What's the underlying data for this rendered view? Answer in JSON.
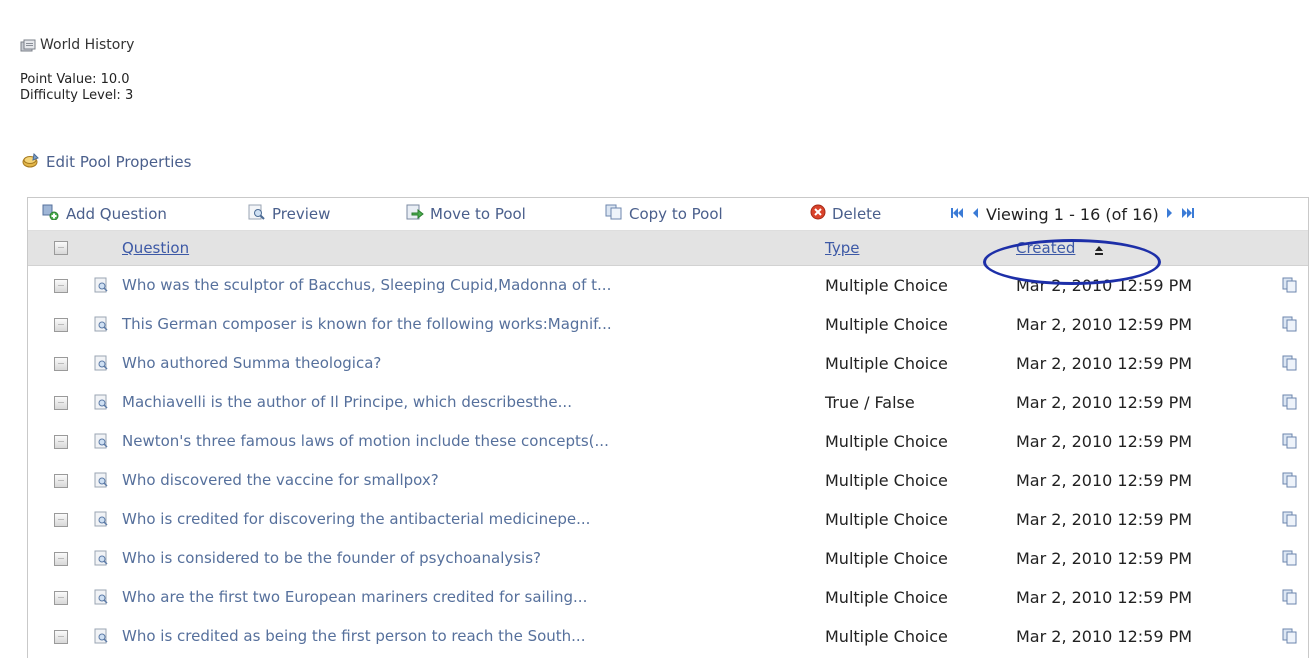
{
  "pool": {
    "title": "World History",
    "point_value": "Point Value: 10.0",
    "difficulty": "Difficulty Level: 3"
  },
  "edit_props_label": "Edit Pool Properties",
  "toolbar": {
    "add_question": "Add Question",
    "preview": "Preview",
    "move_to_pool": "Move to Pool",
    "copy_to_pool": "Copy to Pool",
    "delete": "Delete",
    "viewing": "Viewing 1 - 16 (of 16)"
  },
  "columns": {
    "question": "Question",
    "type": "Type",
    "created": "Created"
  },
  "rows": [
    {
      "question": "Who was the sculptor of Bacchus, Sleeping Cupid,Madonna of t...",
      "type": "Multiple Choice",
      "created": "Mar 2, 2010 12:59 PM"
    },
    {
      "question": "This German composer is known for the following works:Magnif...",
      "type": "Multiple Choice",
      "created": "Mar 2, 2010 12:59 PM"
    },
    {
      "question": "Who authored Summa theologica?",
      "type": "Multiple Choice",
      "created": "Mar 2, 2010 12:59 PM"
    },
    {
      "question": "Machiavelli is the author of Il Principe, which describesthe...",
      "type": "True / False",
      "created": "Mar 2, 2010 12:59 PM"
    },
    {
      "question": "Newton's three famous laws of motion include these concepts(...",
      "type": "Multiple Choice",
      "created": "Mar 2, 2010 12:59 PM"
    },
    {
      "question": "Who discovered the vaccine for smallpox?",
      "type": "Multiple Choice",
      "created": "Mar 2, 2010 12:59 PM"
    },
    {
      "question": "Who is credited for discovering the antibacterial medicinepe...",
      "type": "Multiple Choice",
      "created": "Mar 2, 2010 12:59 PM"
    },
    {
      "question": "Who is considered to be the founder of psychoanalysis?",
      "type": "Multiple Choice",
      "created": "Mar 2, 2010 12:59 PM"
    },
    {
      "question": "Who are the first two European mariners credited for sailing...",
      "type": "Multiple Choice",
      "created": "Mar 2, 2010 12:59 PM"
    },
    {
      "question": "Who is credited as being the first person to reach the South...",
      "type": "Multiple Choice",
      "created": "Mar 2, 2010 12:59 PM"
    }
  ],
  "colors": {
    "link": "#4a5f8c",
    "header_bg": "#e3e3e3",
    "highlight_circle": "#1d2fa8"
  },
  "icons": {
    "pool": "pool-icon",
    "edit": "edit-properties-icon",
    "add": "add-question-icon",
    "preview": "preview-icon",
    "move": "move-to-pool-icon",
    "copy": "copy-to-pool-icon",
    "delete": "delete-icon",
    "first": "first-page-icon",
    "prev": "previous-page-icon",
    "next": "next-page-icon",
    "last": "last-page-icon",
    "sort": "sort-ascending-icon"
  }
}
